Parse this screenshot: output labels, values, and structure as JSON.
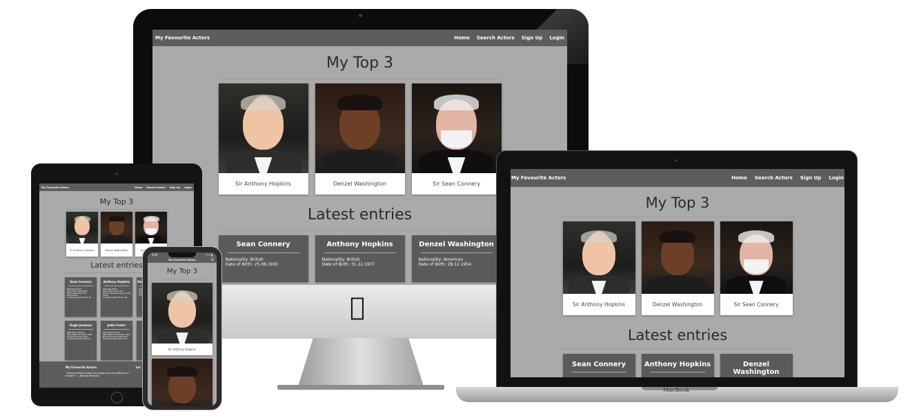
{
  "site": {
    "brand": "My Favourite Actors",
    "nav": [
      "Home",
      "Search Actors",
      "Sign Up",
      "Login"
    ],
    "top_heading": "My Top 3",
    "latest_heading": "Latest entries"
  },
  "top3": [
    {
      "caption": "Sir Anthony Hopkins",
      "photo_icon": "hopkins-portrait"
    },
    {
      "caption": "Denzel Washington",
      "photo_icon": "washington-portrait"
    },
    {
      "caption": "Sir Sean Connery",
      "photo_icon": "connery-portrait"
    }
  ],
  "latest": [
    {
      "name": "Sean Connery",
      "nationality": "Nationality: British",
      "dob": "Date of Birth: 25.08.1930"
    },
    {
      "name": "Anthony Hopkins",
      "nationality": "Nationality: British",
      "dob": "Date of Birth: 31.12.1937"
    },
    {
      "name": "Denzel Washington",
      "nationality": "Nationality: American",
      "dob": "Date of Birth: 28.12.1954"
    }
  ],
  "ipad": {
    "captions": [
      "Sir Anthony Hopkins",
      "Denzel Washington",
      "Sir Sean Connery"
    ],
    "entries": [
      {
        "name": "Sean Connery",
        "facts": [
          "Nationality: British",
          "Date of Birth: 25.08.1930",
          "My Favourite Movie: The Untouchables",
          "Is Academy Award Winner: Yes"
        ]
      },
      {
        "name": "Anthony Hopkins",
        "facts": [
          "Nationality: British",
          "Date of Birth: 31.12.1937",
          "My Favourite Movie: Silence of The Lambs",
          "Is Academy Award Winner: Yes"
        ]
      },
      {
        "name": "Denzel Washington",
        "facts": [
          "Nationality: American",
          "Date of Birth: 28.12.1954",
          "My Favourite Movie: Training Day",
          "Is Academy Award Winner: Yes"
        ]
      },
      {
        "name": "Hugh Jackman",
        "facts": [
          "Nationality: Australian",
          "Date of Birth: 12 October, 1968",
          "My Favourite Movie: Logan",
          "Is Academy Award Winner: No"
        ]
      },
      {
        "name": "Jodie Foster",
        "facts": [
          "Nationality: American",
          "Date of Birth: 19 November, 1962",
          "My Favourite Movie: Taxi Driver",
          "Is Academy Award Winner: Yes"
        ]
      },
      {
        "name": "",
        "facts": []
      }
    ],
    "footer_title": "My Favourite Actors",
    "footer_quote": "\"Cinema should make you forget you are sitting in a theater.\" — Roman Polanski",
    "footer_col2": "Lin"
  },
  "iphone": {
    "time": "9:41",
    "signal": "••• ▮",
    "caption": "Sir Anthony Hopkins"
  },
  "macbook": {
    "label": "MacBook"
  },
  "imac": {
    "apple_icon": ""
  }
}
